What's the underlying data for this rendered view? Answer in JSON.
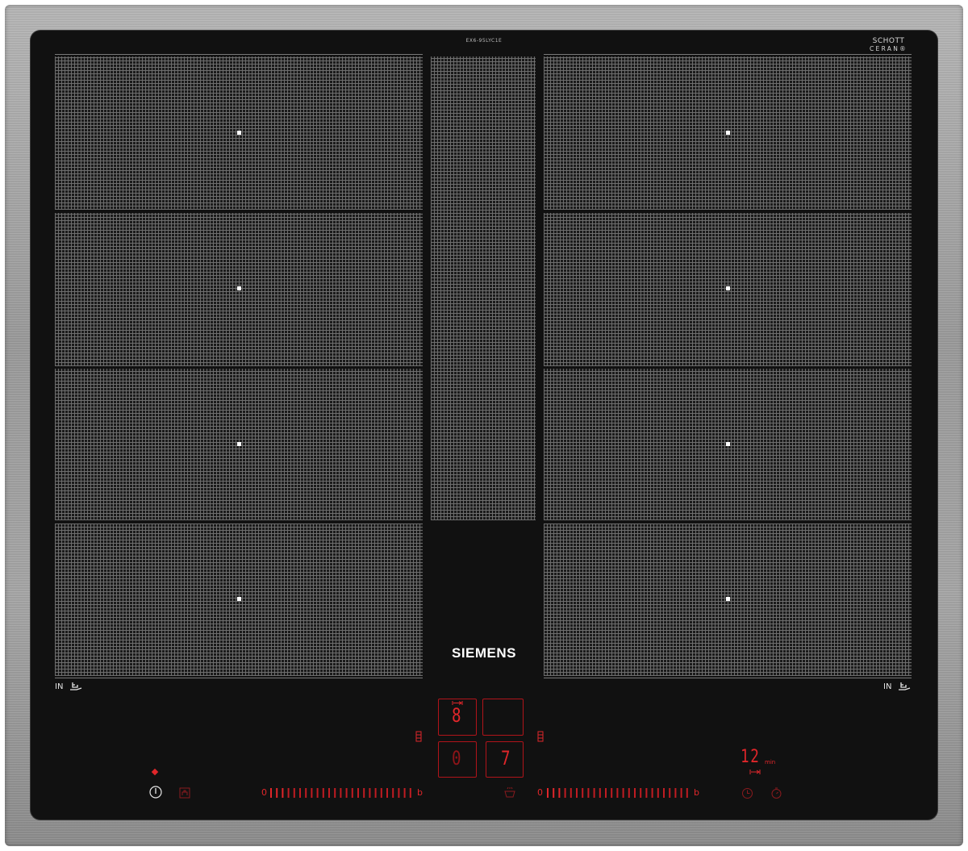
{
  "product": {
    "model_code": "EX6-95LYC1E",
    "brand": "SIEMENS",
    "glass_brand_line1": "SCHOTT",
    "glass_brand_line2": "CERAN®",
    "glass_serial": "---- ------"
  },
  "zones": {
    "left_label": "IN",
    "right_label": "IN"
  },
  "displays": {
    "top_left_digit": "8",
    "bottom_left_digit": "0",
    "bottom_right_digit": "7",
    "timer_value": "12",
    "timer_unit": "min"
  },
  "sliders": {
    "left_min": "0",
    "left_max": "b",
    "right_min": "0",
    "right_max": "b"
  },
  "colors": {
    "accent": "#e0262a",
    "glass": "#111111",
    "frame": "#a0a0a0"
  },
  "icons": [
    "power-icon",
    "power-indicator-dot",
    "childlock-icon",
    "wipe-protection-icon",
    "timer-clock-icon",
    "stopwatch-icon",
    "pan-icon",
    "bridge-icon"
  ]
}
